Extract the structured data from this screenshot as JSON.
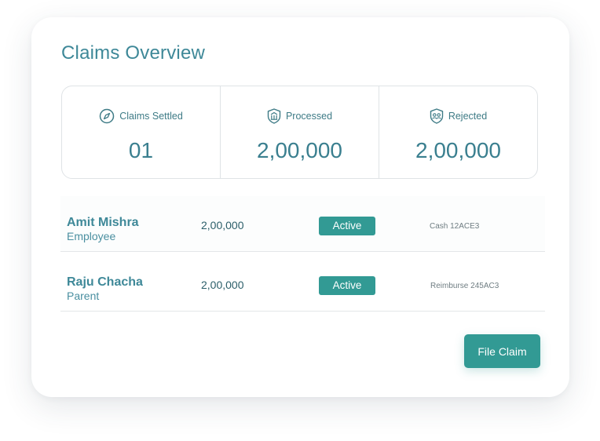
{
  "card": {
    "title": "Claims Overview"
  },
  "stats": [
    {
      "label": "Claims Settled",
      "value": "01",
      "icon": "compass-icon"
    },
    {
      "label": "Processed",
      "value": "2,00,000",
      "icon": "shield-building-icon"
    },
    {
      "label": "Rejected",
      "value": "2,00,000",
      "icon": "shield-people-icon"
    }
  ],
  "claims": [
    {
      "name": "Amit Mishra",
      "role": "Employee",
      "amount": "2,00,000",
      "status": "Active",
      "reference": "Cash 12ACE3"
    },
    {
      "name": "Raju Chacha",
      "role": "Parent",
      "amount": "2,00,000",
      "status": "Active",
      "reference": "Reimburse 245AC3"
    }
  ],
  "actions": {
    "file_claim_label": "File Claim"
  },
  "colors": {
    "accent": "#329a94",
    "title": "#3e8898",
    "border": "#dfe3e6"
  }
}
